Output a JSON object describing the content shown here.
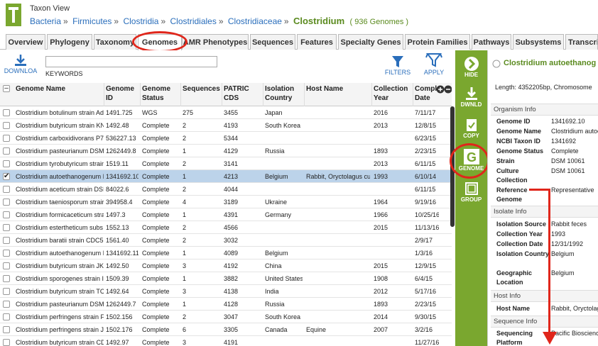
{
  "header": {
    "view_title": "Taxon View",
    "crumbs": [
      "Bacteria",
      "Firmicutes",
      "Clostridia",
      "Clostridiales",
      "Clostridiaceae"
    ],
    "current": "Clostridium",
    "count": "( 936 Genomes )"
  },
  "tabs": [
    "Overview",
    "Phylogeny",
    "Taxonomy",
    "Genomes",
    "AMR Phenotypes",
    "Sequences",
    "Features",
    "Specialty Genes",
    "Protein Families",
    "Pathways",
    "Subsystems",
    "Transcri"
  ],
  "toolbar": {
    "download_label": "DOWNLOA",
    "keywords_label": "KEYWORDS",
    "keywords_value": "",
    "filters_label": "FILTERS",
    "apply_label": "APPLY"
  },
  "columns": [
    "Genome Name",
    "Genome ID",
    "Genome Status",
    "Sequences",
    "PATRIC CDS",
    "Isolation Country",
    "Host Name",
    "Collection Year",
    "Completion Date"
  ],
  "rows": [
    [
      "Clostridium botulinum strain Ad",
      "1491.725",
      "WGS",
      "275",
      "3455",
      "Japan",
      "",
      "2016",
      "7/11/17"
    ],
    [
      "Clostridium butyricum strain KN",
      "1492.48",
      "Complete",
      "2",
      "4193",
      "South Korea",
      "",
      "2013",
      "12/8/15"
    ],
    [
      "Clostridium carboxidivorans P7",
      "536227.13",
      "Complete",
      "2",
      "5344",
      "",
      "",
      "",
      "6/23/15"
    ],
    [
      "Clostridium pasteurianum DSM",
      "1262449.8",
      "Complete",
      "1",
      "4129",
      "Russia",
      "",
      "1893",
      "2/23/15"
    ],
    [
      "Clostridium tyrobutyricum strain",
      "1519.11",
      "Complete",
      "2",
      "3141",
      "",
      "",
      "2013",
      "6/11/15"
    ],
    [
      "Clostridium autoethanogenum I",
      "1341692.10",
      "Complete",
      "1",
      "4213",
      "Belgium",
      "Rabbit, Oryctolagus cu",
      "1993",
      "6/10/14"
    ],
    [
      "Clostridium aceticum strain DSI",
      "84022.6",
      "Complete",
      "2",
      "4044",
      "",
      "",
      "",
      "6/11/15"
    ],
    [
      "Clostridium taeniosporum strair",
      "394958.4",
      "Complete",
      "4",
      "3189",
      "Ukraine",
      "",
      "1964",
      "9/19/16"
    ],
    [
      "Clostridium formicaceticum stra",
      "1497.3",
      "Complete",
      "1",
      "4391",
      "Germany",
      "",
      "1966",
      "10/25/16"
    ],
    [
      "Clostridium estertheticum subs",
      "1552.13",
      "Complete",
      "2",
      "4566",
      "",
      "",
      "2015",
      "11/13/16"
    ],
    [
      "Clostridium baratii strain CDC5",
      "1561.40",
      "Complete",
      "2",
      "3032",
      "",
      "",
      "",
      "2/9/17"
    ],
    [
      "Clostridium autoethanogenum I",
      "1341692.11",
      "Complete",
      "1",
      "4089",
      "Belgium",
      "",
      "",
      "1/3/16"
    ],
    [
      "Clostridium butyricum strain JK",
      "1492.50",
      "Complete",
      "3",
      "4192",
      "China",
      "",
      "2015",
      "12/9/15"
    ],
    [
      "Clostridium sporogenes strain I",
      "1509.39",
      "Complete",
      "1",
      "3882",
      "United States",
      "",
      "1908",
      "6/4/15"
    ],
    [
      "Clostridium butyricum strain TC",
      "1492.64",
      "Complete",
      "3",
      "4138",
      "India",
      "",
      "2012",
      "5/17/16"
    ],
    [
      "Clostridium pasteurianum DSM",
      "1262449.7",
      "Complete",
      "1",
      "4128",
      "Russia",
      "",
      "1893",
      "2/23/15"
    ],
    [
      "Clostridium perfringens strain F",
      "1502.156",
      "Complete",
      "2",
      "3047",
      "South Korea",
      "",
      "2014",
      "9/30/15"
    ],
    [
      "Clostridium perfringens strain J",
      "1502.176",
      "Complete",
      "6",
      "3305",
      "Canada",
      "Equine",
      "2007",
      "3/2/16"
    ],
    [
      "Clostridium butyricum strain CD",
      "1492.97",
      "Complete",
      "3",
      "4191",
      "",
      "",
      "",
      "11/27/16"
    ]
  ],
  "selected_row": 5,
  "actions": {
    "hide": "HIDE",
    "download": "DWNLD",
    "copy": "COPY",
    "genome": "GENOME",
    "group": "GROUP"
  },
  "details": {
    "title": "Clostridium autoethanog",
    "length": "Length: 4352205bp, Chromosome",
    "organism_header": "Organism Info",
    "organism": [
      [
        "Genome ID",
        "1341692.10"
      ],
      [
        "Genome Name",
        "Clostridium autoe"
      ],
      [
        "NCBI Taxon ID",
        "1341692"
      ],
      [
        "Genome Status",
        "Complete"
      ],
      [
        "Strain",
        "DSM 10061"
      ],
      [
        "Culture Collection",
        "DSM 10061"
      ],
      [
        "Reference Genome",
        "Representative"
      ]
    ],
    "isolate_header": "Isolate Info",
    "isolate": [
      [
        "Isolation Source",
        "Rabbit feces"
      ],
      [
        "Collection Year",
        "1993"
      ],
      [
        "Collection Date",
        "12/31/1992"
      ],
      [
        "Isolation Country",
        "Belgium"
      ],
      [
        "Geographic Location",
        "Belgium"
      ]
    ],
    "host_header": "Host Info",
    "host": [
      [
        "Host Name",
        "Rabbit, Oryctolag"
      ]
    ],
    "sequence_header": "Sequence Info",
    "sequence": [
      [
        "Sequencing Platform",
        "Pacific Bioscienc"
      ]
    ]
  },
  "colors": {
    "green": "#7aa72f",
    "link": "#2a6ebb",
    "annotation": "#e0261b",
    "selected": "#bcd3ea"
  }
}
